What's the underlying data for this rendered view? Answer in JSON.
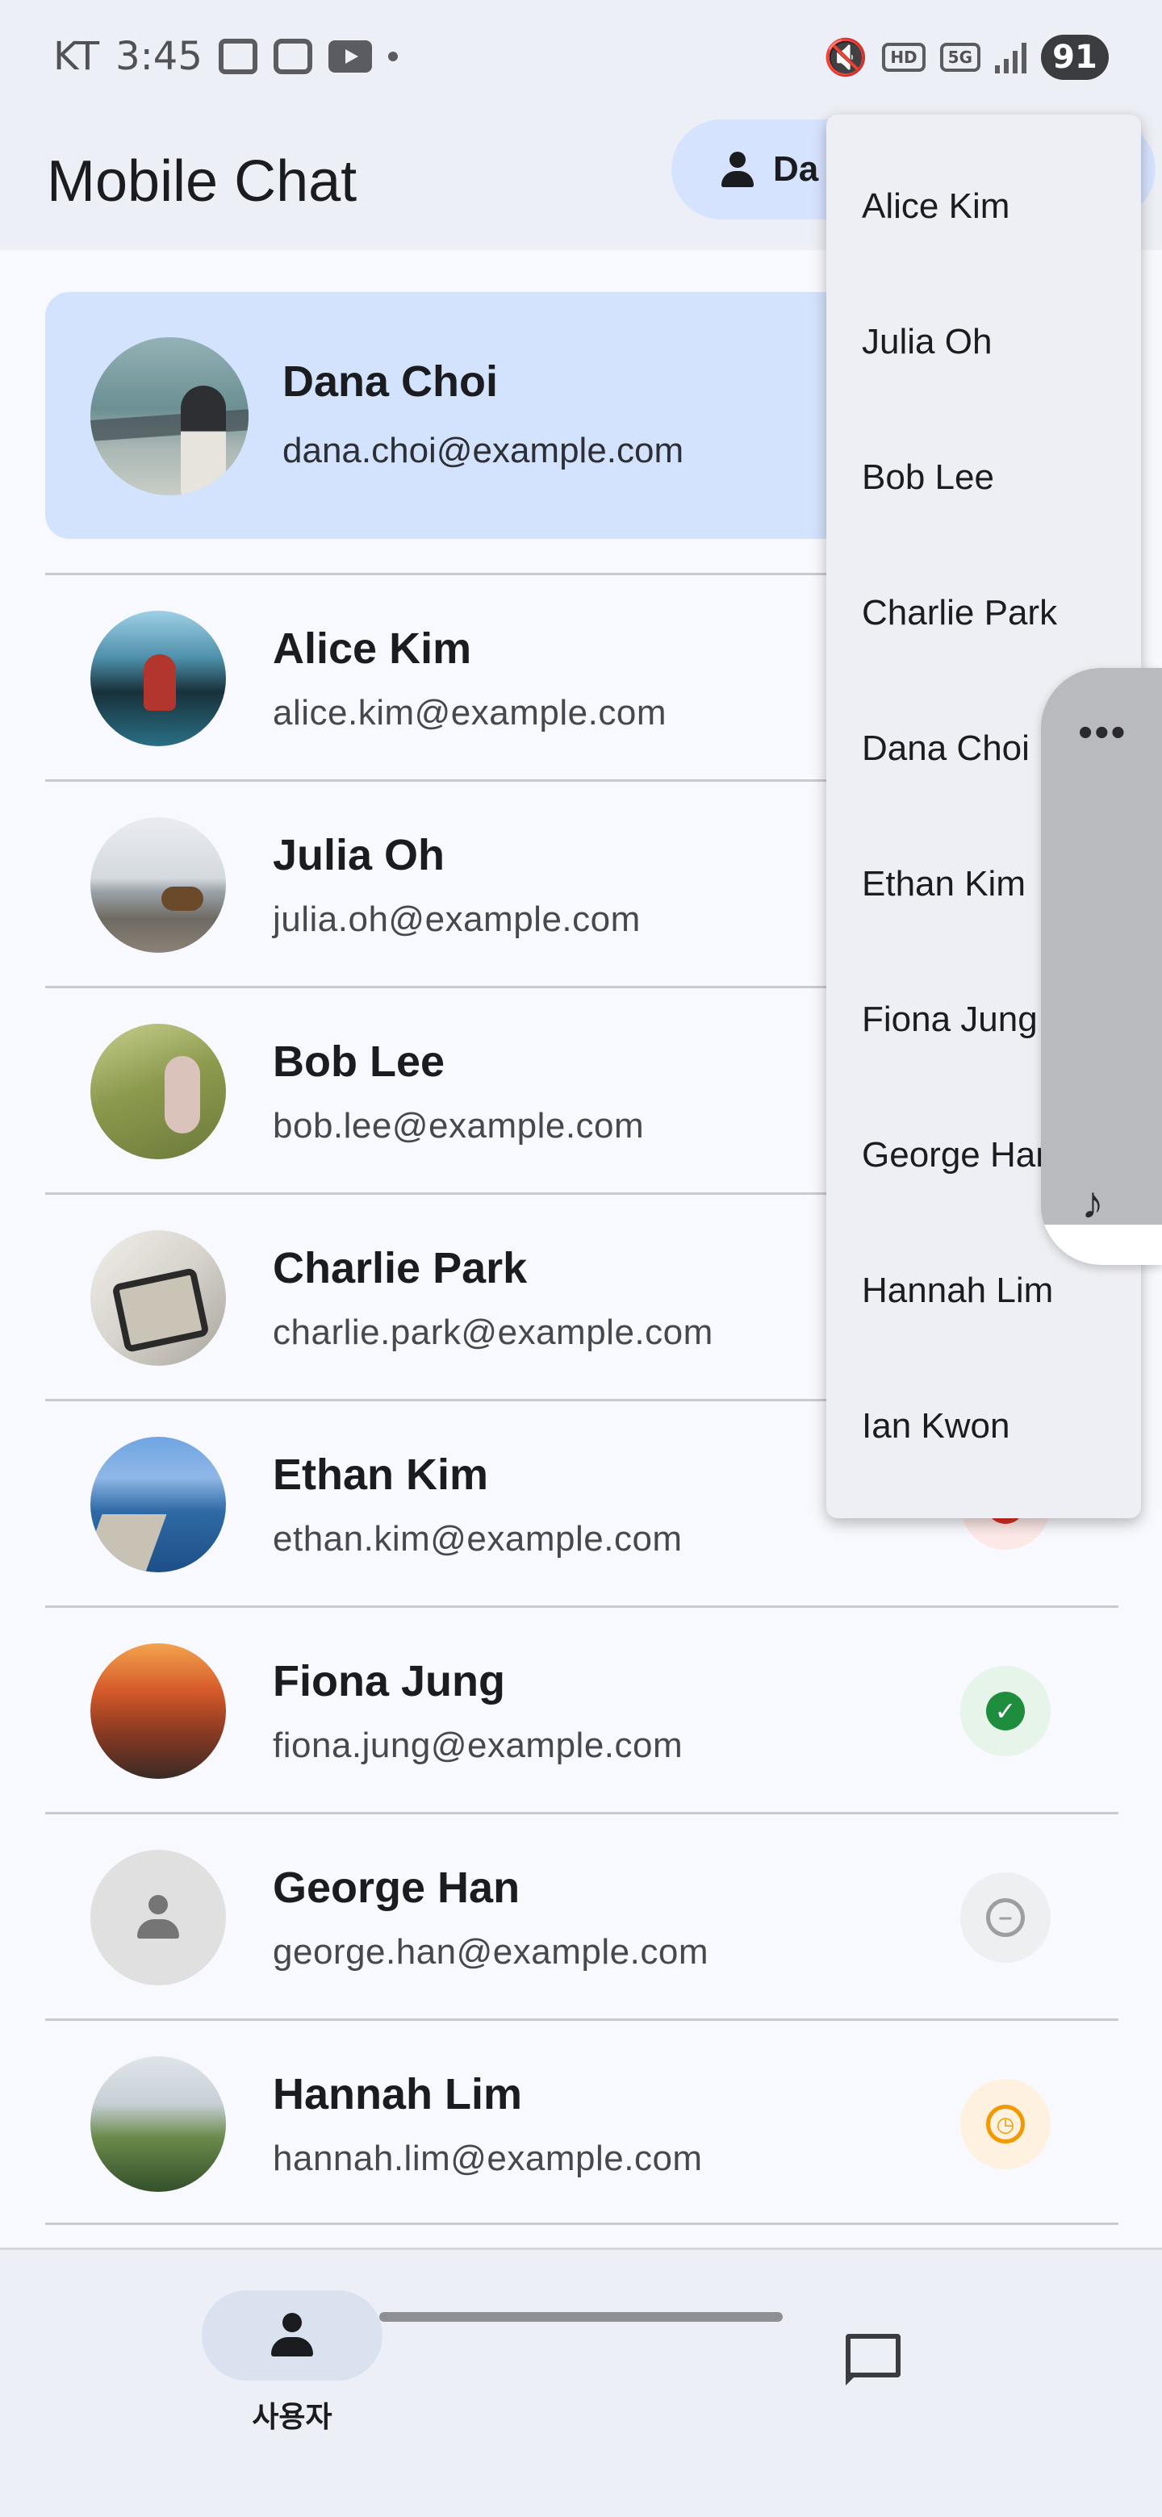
{
  "status_bar": {
    "carrier": "KT",
    "time": "3:45",
    "network_tags": [
      "HD",
      "5G"
    ],
    "battery": "91"
  },
  "app_bar": {
    "title": "Mobile Chat",
    "user_chip": "Da"
  },
  "selected_user": {
    "name": "Dana Choi",
    "email": "dana.choi@example.com"
  },
  "contacts": [
    {
      "name": "Alice Kim",
      "email": "alice.kim@example.com"
    },
    {
      "name": "Julia Oh",
      "email": "julia.oh@example.com"
    },
    {
      "name": "Bob Lee",
      "email": "bob.lee@example.com"
    },
    {
      "name": "Charlie Park",
      "email": "charlie.park@example.com"
    },
    {
      "name": "Ethan Kim",
      "email": "ethan.kim@example.com",
      "status": "busy",
      "status_color": "#d93025"
    },
    {
      "name": "Fiona Jung",
      "email": "fiona.jung@example.com",
      "status": "online",
      "status_color": "#1e8e3e"
    },
    {
      "name": "George Han",
      "email": "george.han@example.com",
      "status": "offline",
      "status_color": "#9e9e9e"
    },
    {
      "name": "Hannah Lim",
      "email": "hannah.lim@example.com",
      "status": "away",
      "status_color": "#f29900"
    }
  ],
  "user_menu": {
    "items": [
      "Alice Kim",
      "Julia Oh",
      "Bob Lee",
      "Charlie Park",
      "Dana Choi",
      "Ethan Kim",
      "Fiona Jung",
      "George Han",
      "Hannah Lim",
      "Ian Kwon"
    ]
  },
  "bottom_nav": {
    "users_label": "사용자"
  },
  "icons": {
    "chip": "person-icon",
    "nav_users": "person-icon",
    "nav_chat": "chat-bubble-icon",
    "widget_more": "more-horiz-icon",
    "widget_music": "music-note-icon"
  }
}
